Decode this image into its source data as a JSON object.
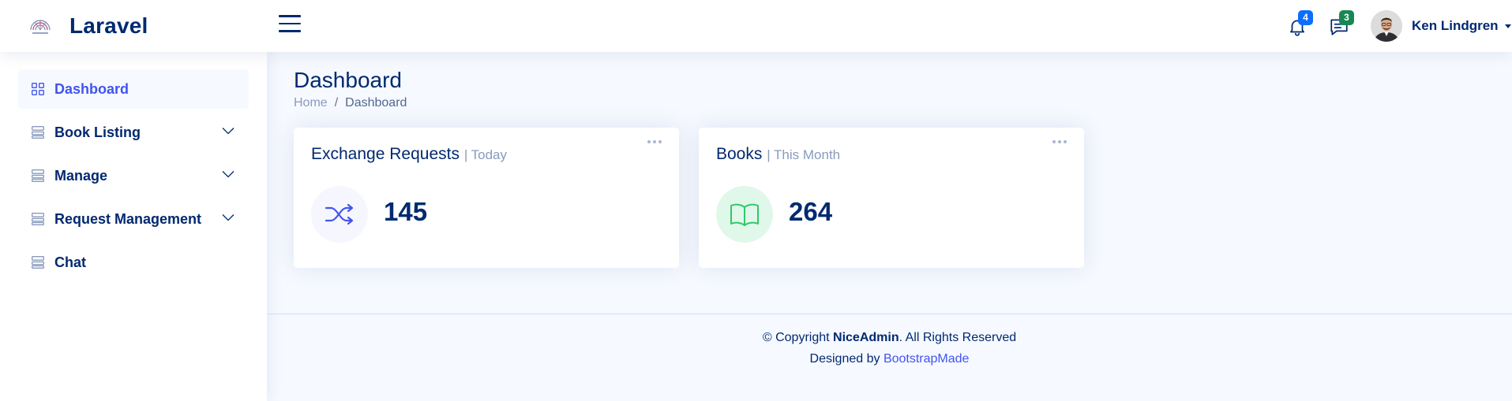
{
  "header": {
    "brand": "Laravel",
    "notifications_count": "4",
    "messages_count": "3",
    "user_name": "Ken Lindgren"
  },
  "sidebar": {
    "items": [
      {
        "label": "Dashboard",
        "icon": "grid-icon",
        "active": true
      },
      {
        "label": "Book Listing",
        "icon": "layout-list-icon",
        "expandable": true
      },
      {
        "label": "Manage",
        "icon": "layout-list-icon",
        "expandable": true
      },
      {
        "label": "Request Management",
        "icon": "layout-list-icon",
        "expandable": true
      },
      {
        "label": "Chat",
        "icon": "layout-list-icon"
      }
    ]
  },
  "page": {
    "title": "Dashboard",
    "breadcrumb": [
      "Home",
      "Dashboard"
    ]
  },
  "cards": [
    {
      "title": "Exchange Requests",
      "subtitle": "| Today",
      "value": "145",
      "icon": "shuffle-icon",
      "icon_bg": "#f6f6fe",
      "icon_color": "#4154f1"
    },
    {
      "title": "Books",
      "subtitle": "| This Month",
      "value": "264",
      "icon": "book-icon",
      "icon_bg": "#e0f8e9",
      "icon_color": "#2eca6a"
    }
  ],
  "footer": {
    "copyright_prefix": "© Copyright",
    "brand": "NiceAdmin",
    "copyright_suffix": ". All Rights Reserved",
    "designed_by": "Designed by",
    "designer": "BootstrapMade"
  },
  "colors": {
    "primary": "#012970",
    "accent": "#4154f1",
    "background": "#f6f9ff"
  }
}
